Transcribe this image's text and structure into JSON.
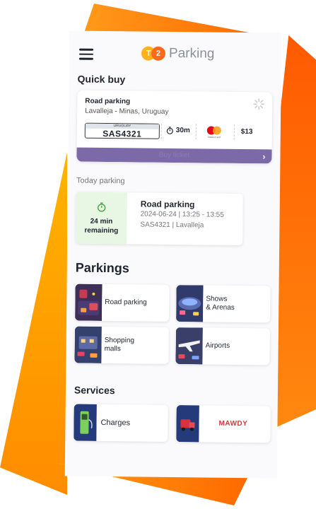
{
  "header": {
    "brand_badge_1": "T",
    "brand_badge_2": "2",
    "brand_name": "Parking"
  },
  "quick_buy": {
    "section_title": "Quick buy",
    "title": "Road parking",
    "location": "Lavalleja - Minas, Uruguay",
    "plate_country": "URUGUAY",
    "plate": "SAS4321",
    "duration": "30m",
    "card_brand": "mastercard",
    "price": "$13",
    "buy_label": "Buy ticket"
  },
  "today_parking": {
    "label": "Today parking",
    "remaining_minutes": "24 min",
    "remaining_label": "remaining",
    "title": "Road parking",
    "date_time": "2024-06-24 | 13:25 - 13:55",
    "plate_location": "SAS4321 | Lavalleja"
  },
  "parkings": {
    "section_title": "Parkings",
    "items": [
      {
        "line1": "Road parking",
        "line2": ""
      },
      {
        "line1": "Shows",
        "line2": "& Arenas"
      },
      {
        "line1": "Shopping",
        "line2": "malls"
      },
      {
        "line1": "Airports",
        "line2": ""
      }
    ]
  },
  "services": {
    "section_title": "Services",
    "items": [
      {
        "label": "Charges"
      },
      {
        "label": "MAWDY"
      }
    ]
  },
  "colors": {
    "accent_purple": "#7c6aa8",
    "brand_orange": "#ff6a1a",
    "brand_yellow": "#ffb21a",
    "timer_green": "#3aa83a"
  }
}
